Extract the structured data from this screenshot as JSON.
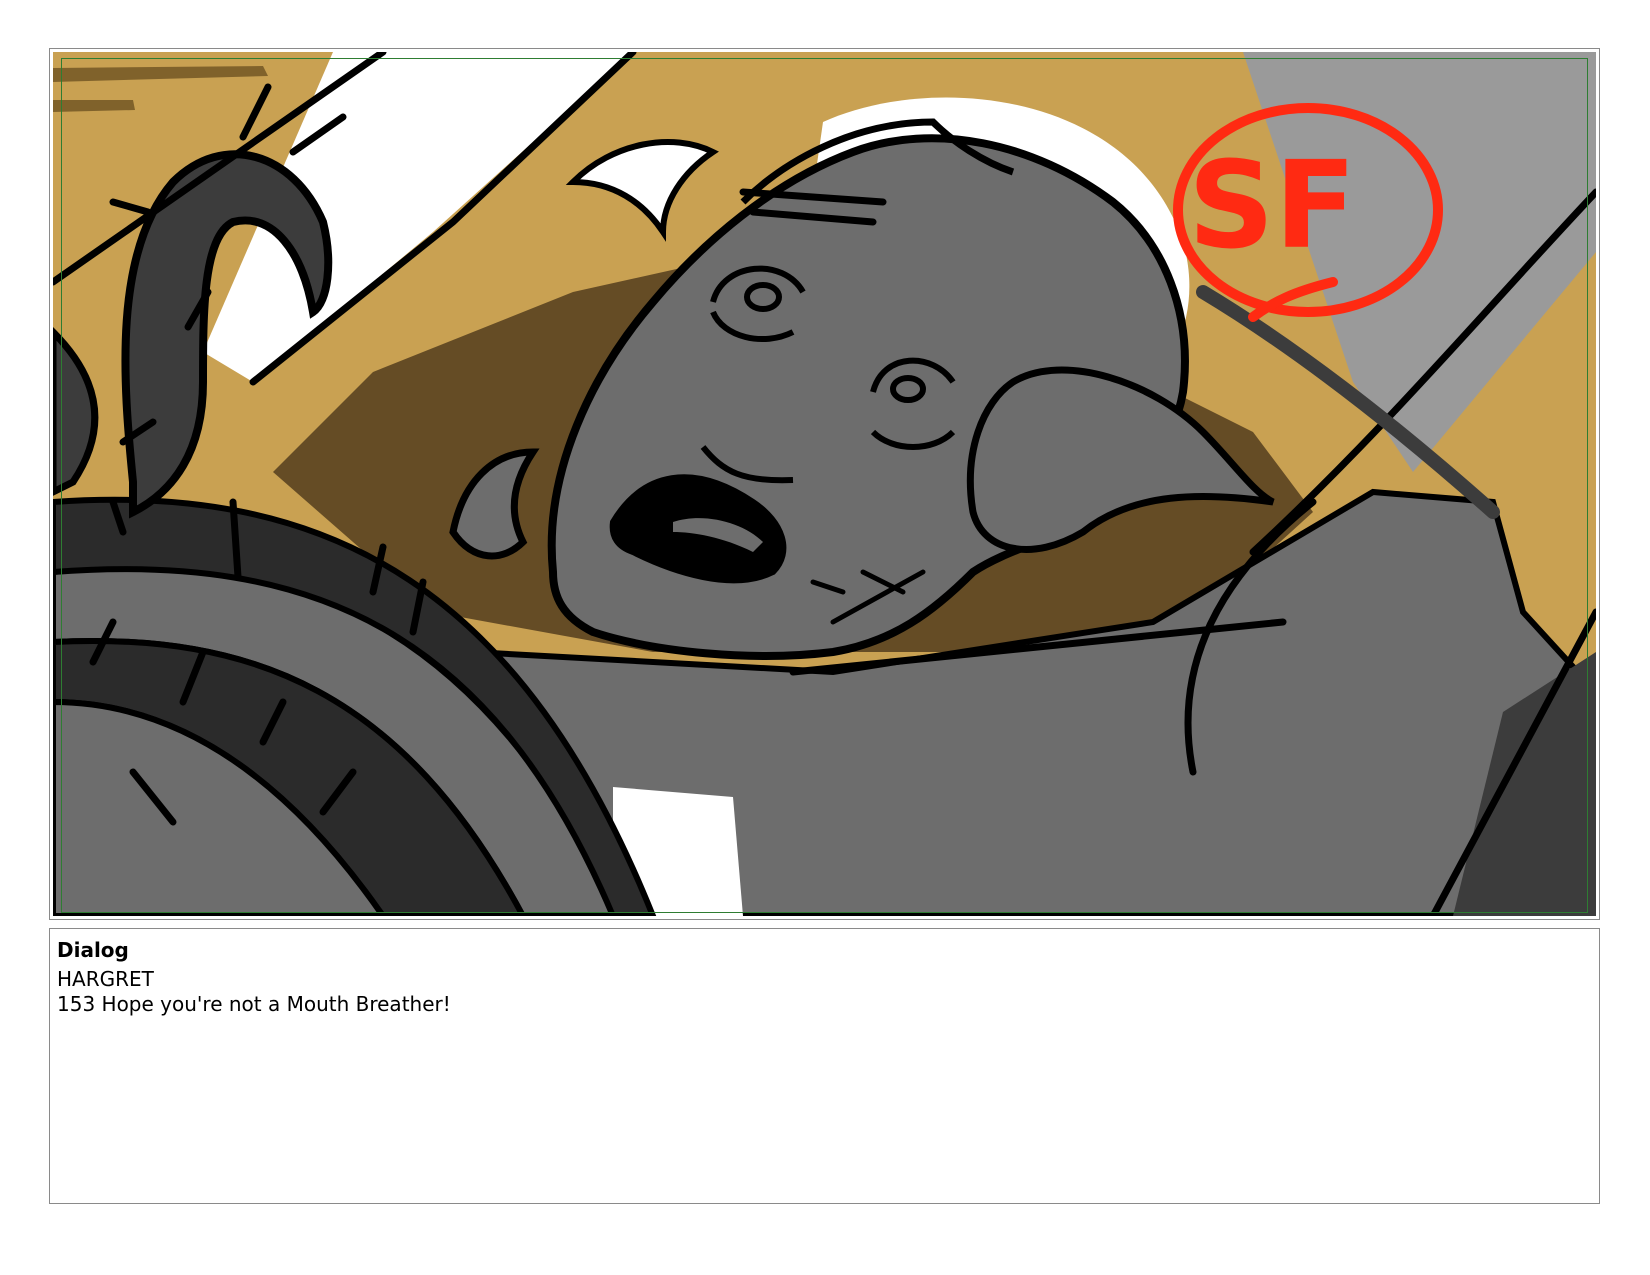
{
  "panel": {
    "watermark_text": "SF",
    "colors": {
      "sky": "#c9a152",
      "sky_shadow": "#6e5222",
      "figure_gray": "#6d6d6d",
      "dark_gray": "#2b2b2b",
      "light_gray": "#9a9a9a",
      "ink": "#000000",
      "highlight": "#ffffff",
      "watermark_red": "#ff2a12",
      "safe_frame": "#2e7d32"
    }
  },
  "dialog": {
    "heading": "Dialog",
    "speaker": "HARGRET",
    "line": "153 Hope you're not a Mouth Breather!"
  }
}
